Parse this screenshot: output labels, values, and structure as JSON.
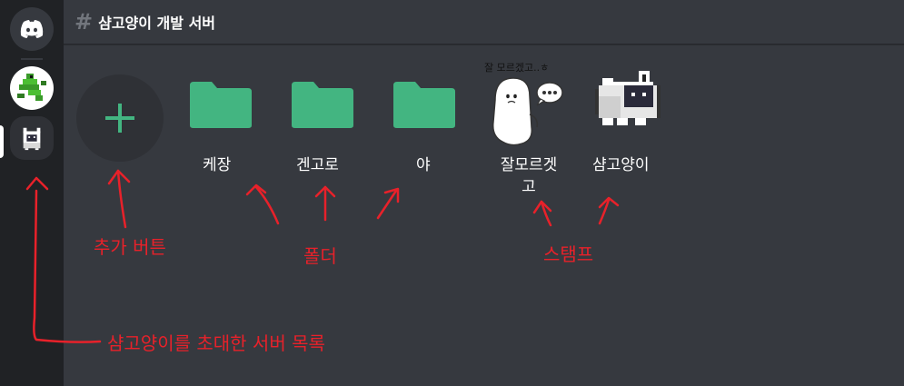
{
  "header": {
    "hash_icon": "hash-icon",
    "channel_name": "샴고양이 개발 서버"
  },
  "sidebar": {
    "home_icon": "discord-logo-icon",
    "servers": [
      {
        "icon": "green-pixel-creature-icon"
      },
      {
        "icon": "pixel-siamese-cat-icon",
        "active": true
      }
    ]
  },
  "picker": {
    "add_button_icon": "plus-icon",
    "folders": [
      {
        "label": "케장",
        "icon": "folder-icon"
      },
      {
        "label": "겐고로",
        "icon": "folder-icon"
      },
      {
        "label": "야",
        "icon": "folder-icon"
      }
    ],
    "stickers": [
      {
        "label_line1": "잘모르겟",
        "label_line2": "고",
        "caption": "잘 모르겠고..ㅎ",
        "icon": "ghost-sticker-icon"
      },
      {
        "label_line1": "샴고양이",
        "icon": "pixel-siamese-cat-icon"
      }
    ]
  },
  "annotations": {
    "add_button": "추가 버튼",
    "folders": "폴더",
    "stickers": "스탬프",
    "server_list": "샴고양이를 초대한 서버 목록"
  },
  "colors": {
    "annotation": "#e8212a",
    "folder": "#43b581",
    "add_plus": "#43b581",
    "background": "#36393f",
    "rail": "#202225"
  }
}
